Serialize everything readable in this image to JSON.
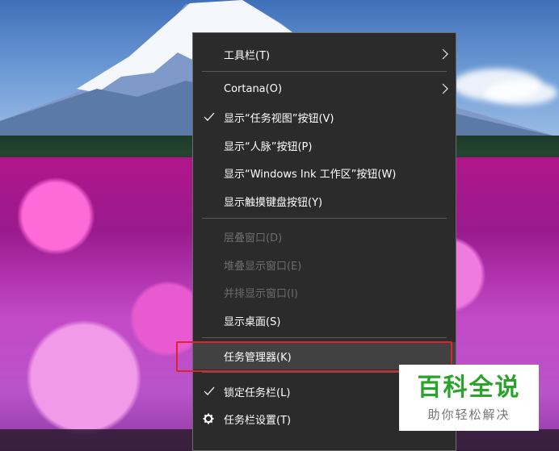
{
  "menu": {
    "items": [
      {
        "label": "工具栏(T)",
        "has_submenu": true,
        "checked": false,
        "disabled": false
      },
      {
        "label": "Cortana(O)",
        "has_submenu": true,
        "checked": false,
        "disabled": false
      },
      {
        "label": "显示“任务视图”按钮(V)",
        "has_submenu": false,
        "checked": true,
        "disabled": false
      },
      {
        "label": "显示“人脉”按钮(P)",
        "has_submenu": false,
        "checked": false,
        "disabled": false
      },
      {
        "label": "显示“Windows Ink 工作区”按钮(W)",
        "has_submenu": false,
        "checked": false,
        "disabled": false
      },
      {
        "label": "显示触摸键盘按钮(Y)",
        "has_submenu": false,
        "checked": false,
        "disabled": false
      },
      {
        "label": "层叠窗口(D)",
        "has_submenu": false,
        "checked": false,
        "disabled": true
      },
      {
        "label": "堆叠显示窗口(E)",
        "has_submenu": false,
        "checked": false,
        "disabled": true
      },
      {
        "label": "并排显示窗口(I)",
        "has_submenu": false,
        "checked": false,
        "disabled": true
      },
      {
        "label": "显示桌面(S)",
        "has_submenu": false,
        "checked": false,
        "disabled": false
      },
      {
        "label": "任务管理器(K)",
        "has_submenu": false,
        "checked": false,
        "disabled": false,
        "highlighted": true
      },
      {
        "label": "锁定任务栏(L)",
        "has_submenu": false,
        "checked": true,
        "disabled": false
      },
      {
        "label": "任务栏设置(T)",
        "has_submenu": false,
        "checked": false,
        "disabled": false,
        "icon": "gear-icon"
      }
    ]
  },
  "icons": {
    "check": "checkmark-icon",
    "submenu": "chevron-right-icon",
    "settings": "gear-icon"
  },
  "colors": {
    "menu_bg": "#2b2b2b",
    "menu_text": "#ffffff",
    "disabled_text": "#6d6d6d",
    "highlight_border": "#d9262c",
    "watermark_green": "#2aa32a"
  },
  "watermark": {
    "title": "百科全说",
    "subtitle": "助你轻松解决"
  }
}
